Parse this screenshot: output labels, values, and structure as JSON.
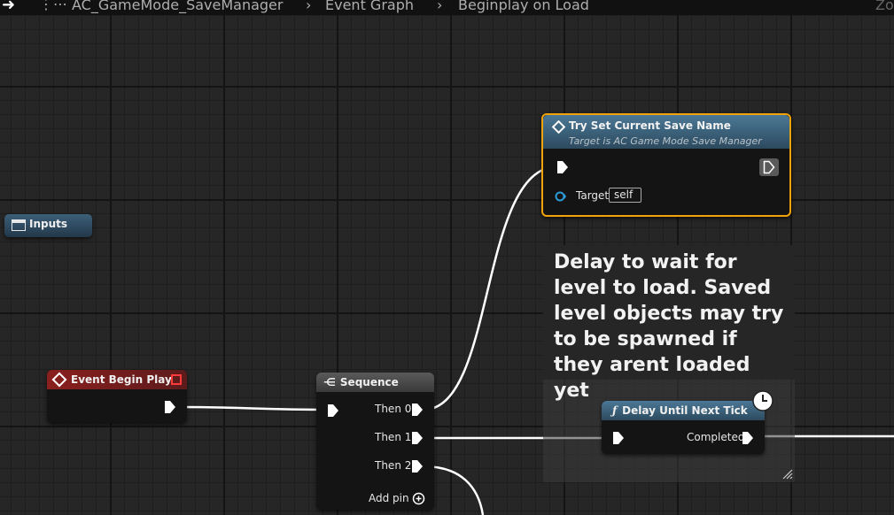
{
  "breadcrumb": {
    "blueprint": "AC_GameMode_SaveManager",
    "graph": "Event Graph",
    "section": "Beginplay on Load",
    "zoom_partial": "Zo"
  },
  "nodes": {
    "inputs": {
      "title": "Inputs"
    },
    "event_begin_play": {
      "title": "Event Begin Play"
    },
    "sequence": {
      "title": "Sequence",
      "then0": "Then 0",
      "then1": "Then 1",
      "then2": "Then 2",
      "add_pin": "Add pin"
    },
    "try_set_save": {
      "title": "Try Set Current Save Name",
      "subtitle": "Target is AC Game Mode Save Manager",
      "target_label": "Target",
      "target_value": "self"
    },
    "delay": {
      "title": "Delay Until Next Tick",
      "completed": "Completed"
    }
  },
  "comment": {
    "text": "Delay to wait for level to load. Saved level objects may try to be spawned if they arent loaded yet"
  },
  "colors": {
    "event_header": "#8a1f1f",
    "function_header": "#3d6680",
    "sequence_header": "#4a4a4a",
    "selection_outline": "#f0a30a",
    "wire": "#ffffff"
  }
}
